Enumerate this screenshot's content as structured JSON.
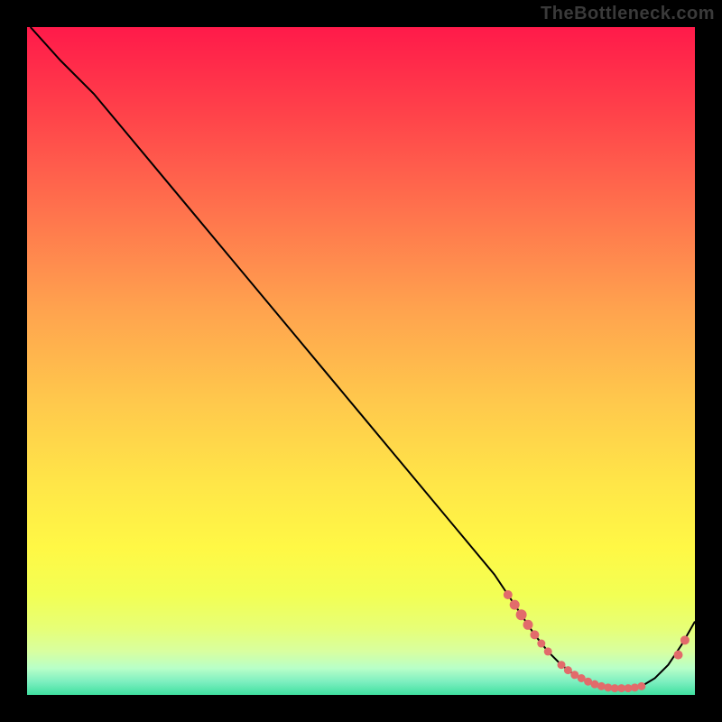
{
  "watermark": "TheBottleneck.com",
  "colors": {
    "dot_fill": "#e26b6b",
    "dot_stroke": "#a84848",
    "curve_stroke": "#000000"
  },
  "chart_data": {
    "type": "line",
    "title": "",
    "xlabel": "",
    "ylabel": "",
    "xlim": [
      0,
      100
    ],
    "ylim": [
      0,
      100
    ],
    "annotations": [],
    "curve": {
      "x": [
        0.5,
        5,
        10,
        15,
        20,
        25,
        30,
        35,
        40,
        45,
        50,
        55,
        60,
        65,
        70,
        72,
        74,
        76,
        78,
        80,
        82,
        84,
        86,
        88,
        90,
        92,
        94,
        96,
        98,
        100
      ],
      "y": [
        100,
        95,
        90,
        84,
        78,
        72,
        66,
        60,
        54,
        48,
        42,
        36,
        30,
        24,
        18,
        15,
        12,
        9,
        6.5,
        4.5,
        3,
        2,
        1.3,
        1,
        1,
        1.3,
        2.5,
        4.5,
        7.5,
        11
      ]
    },
    "score_markers": [
      {
        "x": 72.0,
        "y": 15.0,
        "r": 5.0
      },
      {
        "x": 73.0,
        "y": 13.5,
        "r": 5.5
      },
      {
        "x": 74.0,
        "y": 12.0,
        "r": 6.0
      },
      {
        "x": 75.0,
        "y": 10.5,
        "r": 5.5
      },
      {
        "x": 76.0,
        "y": 9.0,
        "r": 5.0
      },
      {
        "x": 77.0,
        "y": 7.7,
        "r": 4.5
      },
      {
        "x": 78.0,
        "y": 6.5,
        "r": 4.5
      },
      {
        "x": 80.0,
        "y": 4.5,
        "r": 4.5
      },
      {
        "x": 81.0,
        "y": 3.7,
        "r": 4.5
      },
      {
        "x": 82.0,
        "y": 3.0,
        "r": 4.5
      },
      {
        "x": 83.0,
        "y": 2.5,
        "r": 4.5
      },
      {
        "x": 84.0,
        "y": 2.0,
        "r": 4.5
      },
      {
        "x": 85.0,
        "y": 1.6,
        "r": 4.5
      },
      {
        "x": 86.0,
        "y": 1.3,
        "r": 4.5
      },
      {
        "x": 87.0,
        "y": 1.1,
        "r": 4.5
      },
      {
        "x": 88.0,
        "y": 1.0,
        "r": 4.5
      },
      {
        "x": 89.0,
        "y": 1.0,
        "r": 4.5
      },
      {
        "x": 90.0,
        "y": 1.0,
        "r": 4.5
      },
      {
        "x": 91.0,
        "y": 1.1,
        "r": 4.5
      },
      {
        "x": 92.0,
        "y": 1.3,
        "r": 4.5
      },
      {
        "x": 97.5,
        "y": 6.0,
        "r": 5.0
      },
      {
        "x": 98.5,
        "y": 8.2,
        "r": 5.0
      }
    ]
  }
}
